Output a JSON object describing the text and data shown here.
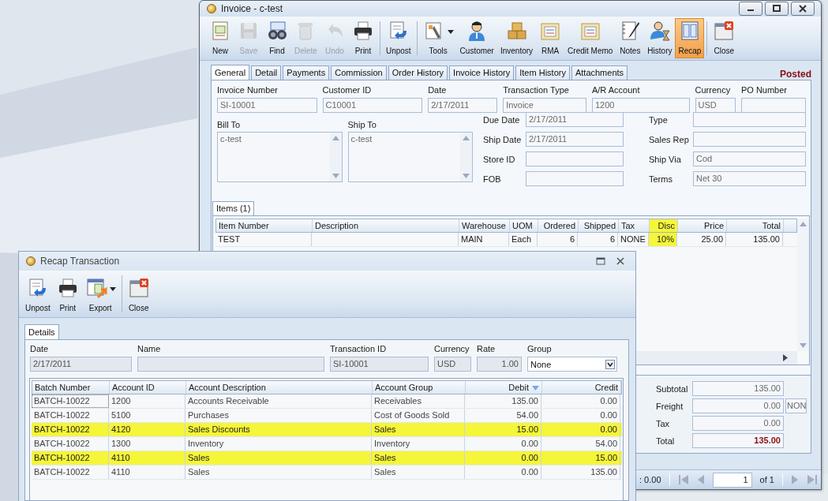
{
  "invoice": {
    "title": "Invoice - c-test",
    "toolbar_groups": [
      [
        {
          "label": "New",
          "disabled": false,
          "selected": false
        },
        {
          "label": "Save",
          "disabled": true,
          "selected": false
        },
        {
          "label": "Find",
          "disabled": false,
          "selected": false
        },
        {
          "label": "Delete",
          "disabled": true,
          "selected": false
        },
        {
          "label": "Undo",
          "disabled": true,
          "selected": false
        },
        {
          "label": "Print",
          "disabled": false,
          "selected": false
        }
      ],
      [
        {
          "label": "Unpost",
          "disabled": false,
          "selected": false
        }
      ],
      [
        {
          "label": "Tools",
          "disabled": false,
          "selected": false,
          "menu": true
        },
        {
          "label": "Customer",
          "disabled": false,
          "selected": false
        },
        {
          "label": "Inventory",
          "disabled": false,
          "selected": false
        },
        {
          "label": "RMA",
          "disabled": false,
          "selected": false
        },
        {
          "label": "Credit Memo",
          "disabled": false,
          "selected": false
        },
        {
          "label": "Notes",
          "disabled": false,
          "selected": false
        },
        {
          "label": "History",
          "disabled": false,
          "selected": false
        },
        {
          "label": "Recap",
          "disabled": false,
          "selected": true
        }
      ],
      [
        {
          "label": "Close",
          "disabled": false,
          "selected": false
        }
      ]
    ],
    "tabs": [
      {
        "label": "General",
        "selected": true
      },
      {
        "label": "Detail",
        "selected": false
      },
      {
        "label": "Payments",
        "selected": false
      },
      {
        "label": "Commission",
        "selected": false
      },
      {
        "label": "Order History",
        "selected": false
      },
      {
        "label": "Invoice History",
        "selected": false
      },
      {
        "label": "Item History",
        "selected": false
      },
      {
        "label": "Attachments",
        "selected": false
      }
    ],
    "status": "Posted",
    "header_fields": [
      {
        "label": "Invoice Number",
        "value": "SI-10001"
      },
      {
        "label": "Customer ID",
        "value": "C10001"
      },
      {
        "label": "Date",
        "value": "2/17/2011"
      },
      {
        "label": "Transaction Type",
        "value": "Invoice"
      },
      {
        "label": "A/R Account",
        "value": "1200"
      },
      {
        "label": "Currency",
        "value": "USD"
      },
      {
        "label": "PO Number"
      }
    ],
    "addresses": [
      {
        "label": "Bill To",
        "value": "c-test"
      },
      {
        "label": "Ship To",
        "value": "c-test"
      }
    ],
    "middle_fields": [
      {
        "label": "Due Date",
        "value": "2/17/2011"
      },
      {
        "label": "Ship Date",
        "value": "2/17/2011"
      },
      {
        "label": "Store ID"
      },
      {
        "label": "FOB"
      }
    ],
    "right_fields": [
      {
        "label": "Type"
      },
      {
        "label": "Sales Rep"
      },
      {
        "label": "Ship Via",
        "value": "Cod"
      },
      {
        "label": "Terms",
        "value": "Net 30"
      }
    ],
    "items_tab": "Items (1)",
    "items": {
      "columns": [
        {
          "label": "Item Number",
          "highlighted": false
        },
        {
          "label": "Description",
          "highlighted": false
        },
        {
          "label": "Warehouse",
          "highlighted": false
        },
        {
          "label": "UOM",
          "highlighted": false
        },
        {
          "label": "Ordered",
          "highlighted": false
        },
        {
          "label": "Shipped",
          "highlighted": false
        },
        {
          "label": "Tax",
          "highlighted": false
        },
        {
          "label": "Disc",
          "highlighted": true
        },
        {
          "label": "Price",
          "highlighted": false
        },
        {
          "label": "Total",
          "highlighted": false
        }
      ],
      "rows": [
        [
          "TEST",
          "",
          "MAIN",
          "Each",
          "6",
          "6",
          "NONE",
          "10%",
          "25.00",
          "135.00"
        ]
      ]
    },
    "totals": [
      {
        "label": "Subtotal",
        "value": "135.00",
        "emphasis": false
      },
      {
        "label": "Freight",
        "value": "0.00",
        "emphasis": false,
        "tax_code": "NON"
      },
      {
        "label": "Tax",
        "value": "0.00",
        "emphasis": false
      },
      {
        "label": "Total",
        "value": "135.00",
        "emphasis": true
      }
    ],
    "pager": {
      "balance": ": 0.00",
      "page": "1",
      "of": "of 1"
    }
  },
  "recap": {
    "title": "Recap Transaction",
    "toolbar": [
      {
        "label": "Unpost"
      },
      {
        "label": "Print"
      },
      {
        "label": "Export",
        "menu": true
      },
      {
        "label": "Close"
      }
    ],
    "tabs": [
      {
        "label": "Details",
        "selected": true
      }
    ],
    "fields": [
      {
        "label": "Date",
        "value": "2/17/2011"
      },
      {
        "label": "Name"
      },
      {
        "label": "Transaction ID",
        "value": "SI-10001"
      },
      {
        "label": "Currency",
        "value": "USD"
      },
      {
        "label": "Rate",
        "value": "1.00"
      },
      {
        "label": "Group",
        "value": "None",
        "kind": "dropdown"
      }
    ],
    "columns": [
      {
        "label": "Batch Number",
        "sorted": false
      },
      {
        "label": "Account ID",
        "sorted": false
      },
      {
        "label": "Account Description",
        "sorted": false
      },
      {
        "label": "Account Group",
        "sorted": false
      },
      {
        "label": "Debit",
        "sorted": true
      },
      {
        "label": "Credit",
        "sorted": false
      }
    ],
    "rows": [
      {
        "cells": [
          "BATCH-10022",
          "1200",
          "Accounts Receivable",
          "Receivables",
          "135.00",
          "0.00"
        ],
        "highlighted": false
      },
      {
        "cells": [
          "BATCH-10022",
          "5100",
          "Purchases",
          "Cost of Goods Sold",
          "54.00",
          "0.00"
        ],
        "highlighted": false
      },
      {
        "cells": [
          "BATCH-10022",
          "4120",
          "Sales Discounts",
          "Sales",
          "15.00",
          "0.00"
        ],
        "highlighted": true
      },
      {
        "cells": [
          "BATCH-10022",
          "1300",
          "Inventory",
          "Inventory",
          "0.00",
          "54.00"
        ],
        "highlighted": false
      },
      {
        "cells": [
          "BATCH-10022",
          "4110",
          "Sales",
          "Sales",
          "0.00",
          "15.00"
        ],
        "highlighted": true
      },
      {
        "cells": [
          "BATCH-10022",
          "4110",
          "Sales",
          "Sales",
          "0.00",
          "135.00"
        ],
        "highlighted": false
      }
    ]
  }
}
